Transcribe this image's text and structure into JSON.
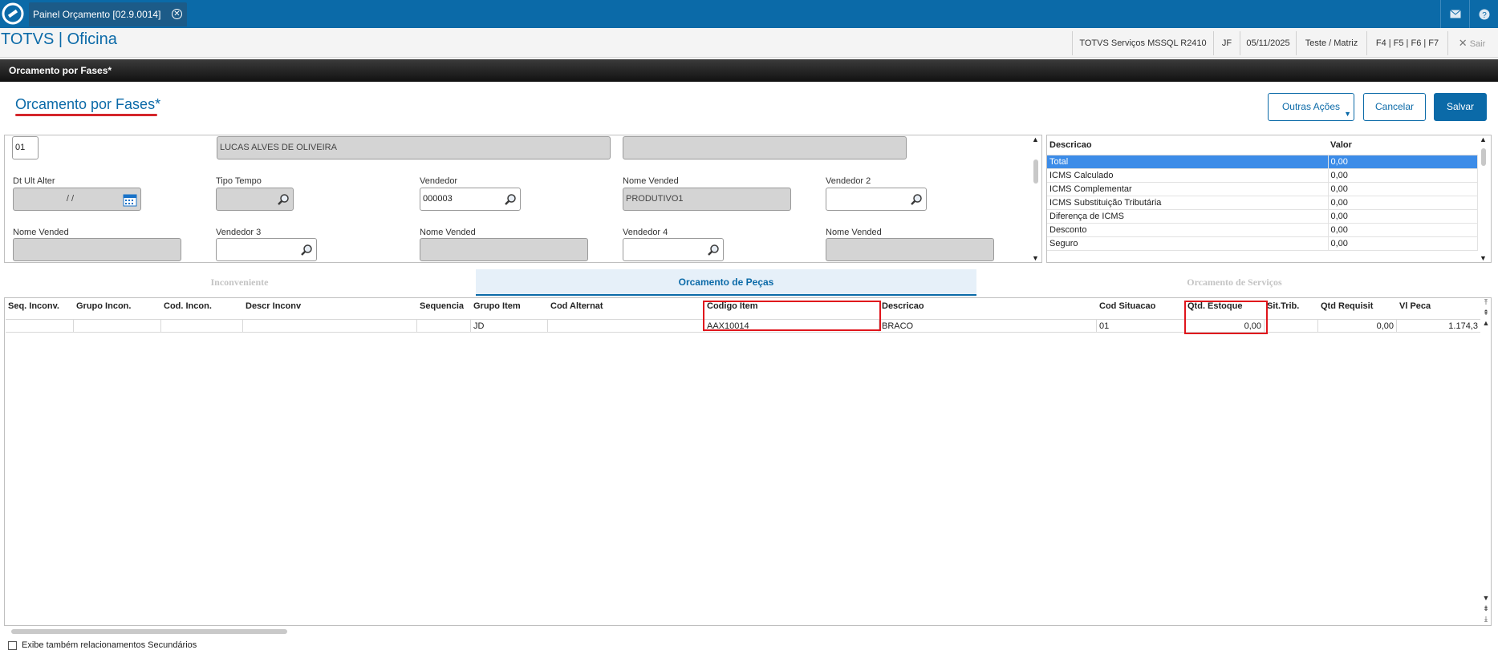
{
  "topbar": {
    "tab_label": "Painel Orçamento [02.9.0014]",
    "close_glyph": "✕",
    "mail_icon": "mail-icon",
    "help_icon": "help-icon"
  },
  "header": {
    "app_title": "TOTVS | Oficina",
    "environment": "TOTVS Serviços MSSQL R2410",
    "user": "JF",
    "date": "05/11/2025",
    "branch": "Teste / Matriz",
    "shortcuts": "F4 | F5 | F6 | F7",
    "exit_label": "Sair"
  },
  "breadcrumb": "Orcamento por Fases*",
  "page": {
    "title": "Orcamento por Fases*",
    "actions": {
      "more": "Outras Ações",
      "cancel": "Cancelar",
      "save": "Salvar"
    }
  },
  "form": {
    "code_value": "01",
    "client_name": "LUCAS ALVES DE OLIVEIRA",
    "blank_field": "",
    "dt_ult_alter_label": "Dt Ult Alter",
    "dt_ult_alter_value": "  /  /",
    "tipo_tempo_label": "Tipo Tempo",
    "tipo_tempo_value": "",
    "vendedor_label": "Vendedor",
    "vendedor_value": "000003",
    "nome_vended_label": "Nome Vended",
    "nome_vended_value": "PRODUTIVO1",
    "vendedor2_label": "Vendedor 2",
    "vendedor2_value": "",
    "nome_vended2_label": "Nome Vended",
    "vendedor3_label": "Vendedor 3",
    "nome_vended3_label": "Nome Vended",
    "vendedor4_label": "Vendedor 4",
    "nome_vended4_label": "Nome Vended"
  },
  "values_table": {
    "headers": [
      "Descricao",
      "Valor"
    ],
    "rows": [
      [
        "Total",
        "0,00"
      ],
      [
        "ICMS Calculado",
        "0,00"
      ],
      [
        "ICMS Complementar",
        "0,00"
      ],
      [
        "ICMS Substituição Tributária",
        "0,00"
      ],
      [
        "Diferença de ICMS",
        "0,00"
      ],
      [
        "Desconto",
        "0,00"
      ],
      [
        "Seguro",
        "0,00"
      ]
    ]
  },
  "tabs": [
    "Inconveniente",
    "Orcamento de Peças",
    "Orcamento de Serviços"
  ],
  "grid": {
    "headers": [
      "Seq. Inconv.",
      "Grupo Incon.",
      "Cod. Incon.",
      "Descr Inconv",
      "Sequencia",
      "Grupo Item",
      "Cod Alternat",
      "Codigo Item",
      "Descricao",
      "Cod Situacao",
      "Qtd. Estoque",
      "Sit.Trib.",
      "Qtd Requisit",
      "Vl Peca"
    ],
    "row": [
      "",
      "",
      "",
      "",
      "",
      "JD",
      "",
      "AAX10014",
      "BRACO",
      "01",
      "0,00",
      "",
      "0,00",
      "1.174,3"
    ]
  },
  "footer": {
    "secondary_label": "Exibe também relacionamentos Secundários"
  },
  "colors": {
    "brand": "#0b6aa8",
    "highlight": "#e0151c",
    "selected_row": "#3c8ce8"
  }
}
